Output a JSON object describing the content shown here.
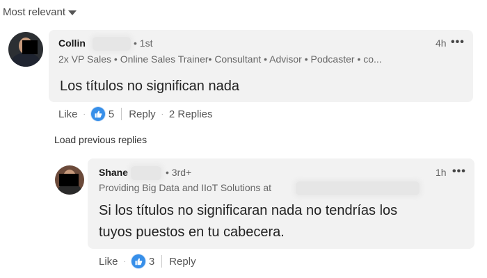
{
  "sort": {
    "label": "Most relevant"
  },
  "load_previous": "Load previous replies",
  "comments": [
    {
      "name": "Collin",
      "degree": "• 1st",
      "headline": "2x VP Sales • Online Sales Trainer• Consultant • Advisor • Podcaster • co...",
      "time": "4h",
      "more": "•••",
      "text": "Los títulos no significan nada",
      "actions": {
        "like": "Like",
        "separator": "·",
        "reaction_count": "5",
        "reply": "Reply",
        "replies": "2 Replies"
      }
    },
    {
      "name": "Shane",
      "degree": "• 3rd+",
      "headline": "Providing Big Data and IIoT Solutions at",
      "time": "1h",
      "more": "•••",
      "text_lines": [
        "Si los títulos no significaran nada no tendrías los",
        "tuyos puestos en tu cabecera."
      ],
      "actions": {
        "like": "Like",
        "separator": "·",
        "reaction_count": "3",
        "reply": "Reply"
      }
    }
  ],
  "colors": {
    "accent": "#378fe9",
    "bubble": "#f2f2f2"
  }
}
